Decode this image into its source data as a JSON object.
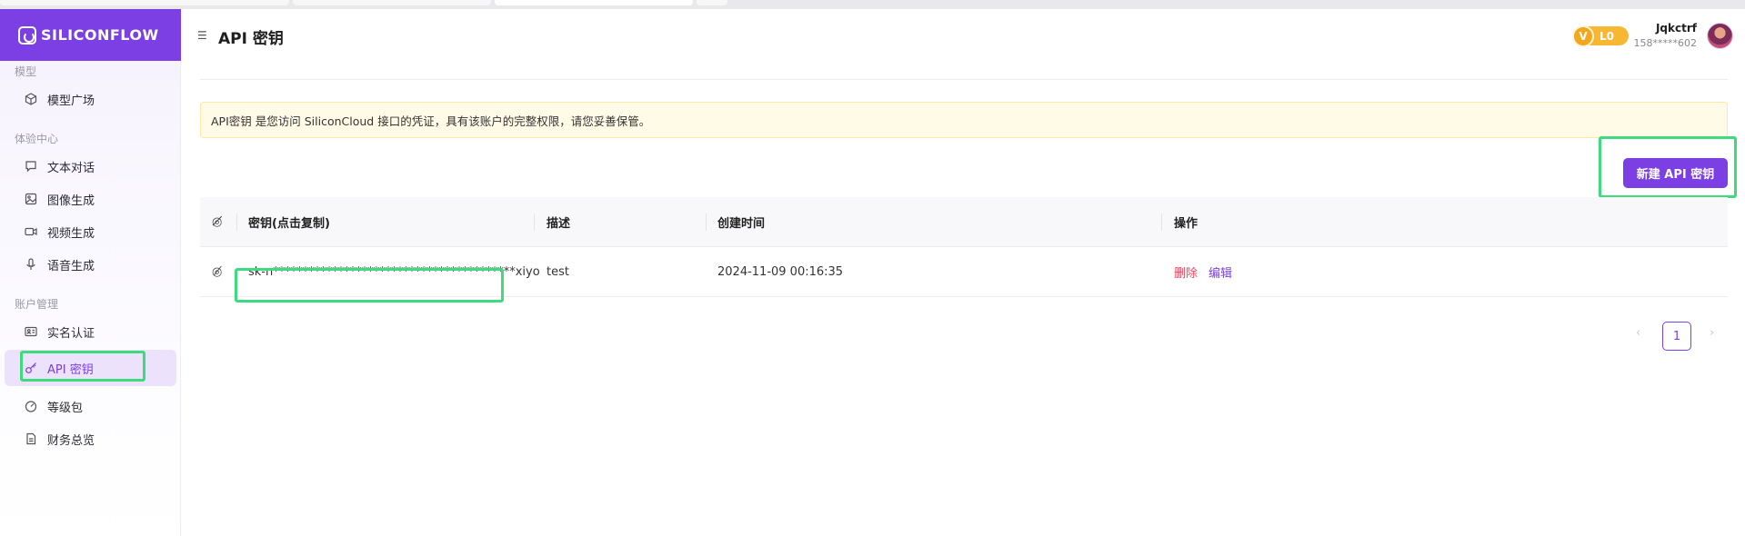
{
  "brand": {
    "name": "SILICONFLOW"
  },
  "sidebar": {
    "sections": [
      {
        "title": "模型",
        "items": [
          {
            "label": "模型广场",
            "icon": "cube-icon"
          }
        ]
      },
      {
        "title": "体验中心",
        "items": [
          {
            "label": "文本对话",
            "icon": "chat-icon"
          },
          {
            "label": "图像生成",
            "icon": "image-icon"
          },
          {
            "label": "视频生成",
            "icon": "video-icon"
          },
          {
            "label": "语音生成",
            "icon": "mic-icon"
          }
        ]
      },
      {
        "title": "账户管理",
        "items": [
          {
            "label": "实名认证",
            "icon": "id-card-icon"
          },
          {
            "label": "API 密钥",
            "icon": "key-icon",
            "active": true
          },
          {
            "label": "等级包",
            "icon": "gauge-icon"
          },
          {
            "label": "财务总览",
            "icon": "document-icon"
          }
        ]
      }
    ]
  },
  "header": {
    "title": "API 密钥",
    "level": "L0",
    "level_letter": "V",
    "user_name": "Jqkctrf",
    "user_phone": "158*****602"
  },
  "notice": "API密钥 是您访问 SiliconCloud 接口的凭证，具有该账户的完整权限，请您妥善保管。",
  "new_key_button": "新建 API 密钥",
  "table": {
    "columns": [
      "密钥(点击复制)",
      "描述",
      "创建时间",
      "操作"
    ],
    "rows": [
      {
        "key": "sk-n*****************************************xiyo",
        "description": "test",
        "created": "2024-11-09 00:16:35",
        "delete_label": "删除",
        "edit_label": "编辑"
      }
    ]
  },
  "pagination": {
    "current": "1",
    "prev": "‹",
    "next": "›"
  },
  "colors": {
    "accent": "#7b3fe4",
    "highlight": "#3ddb7e",
    "danger": "#f5465d",
    "badge": "#f7b733"
  }
}
